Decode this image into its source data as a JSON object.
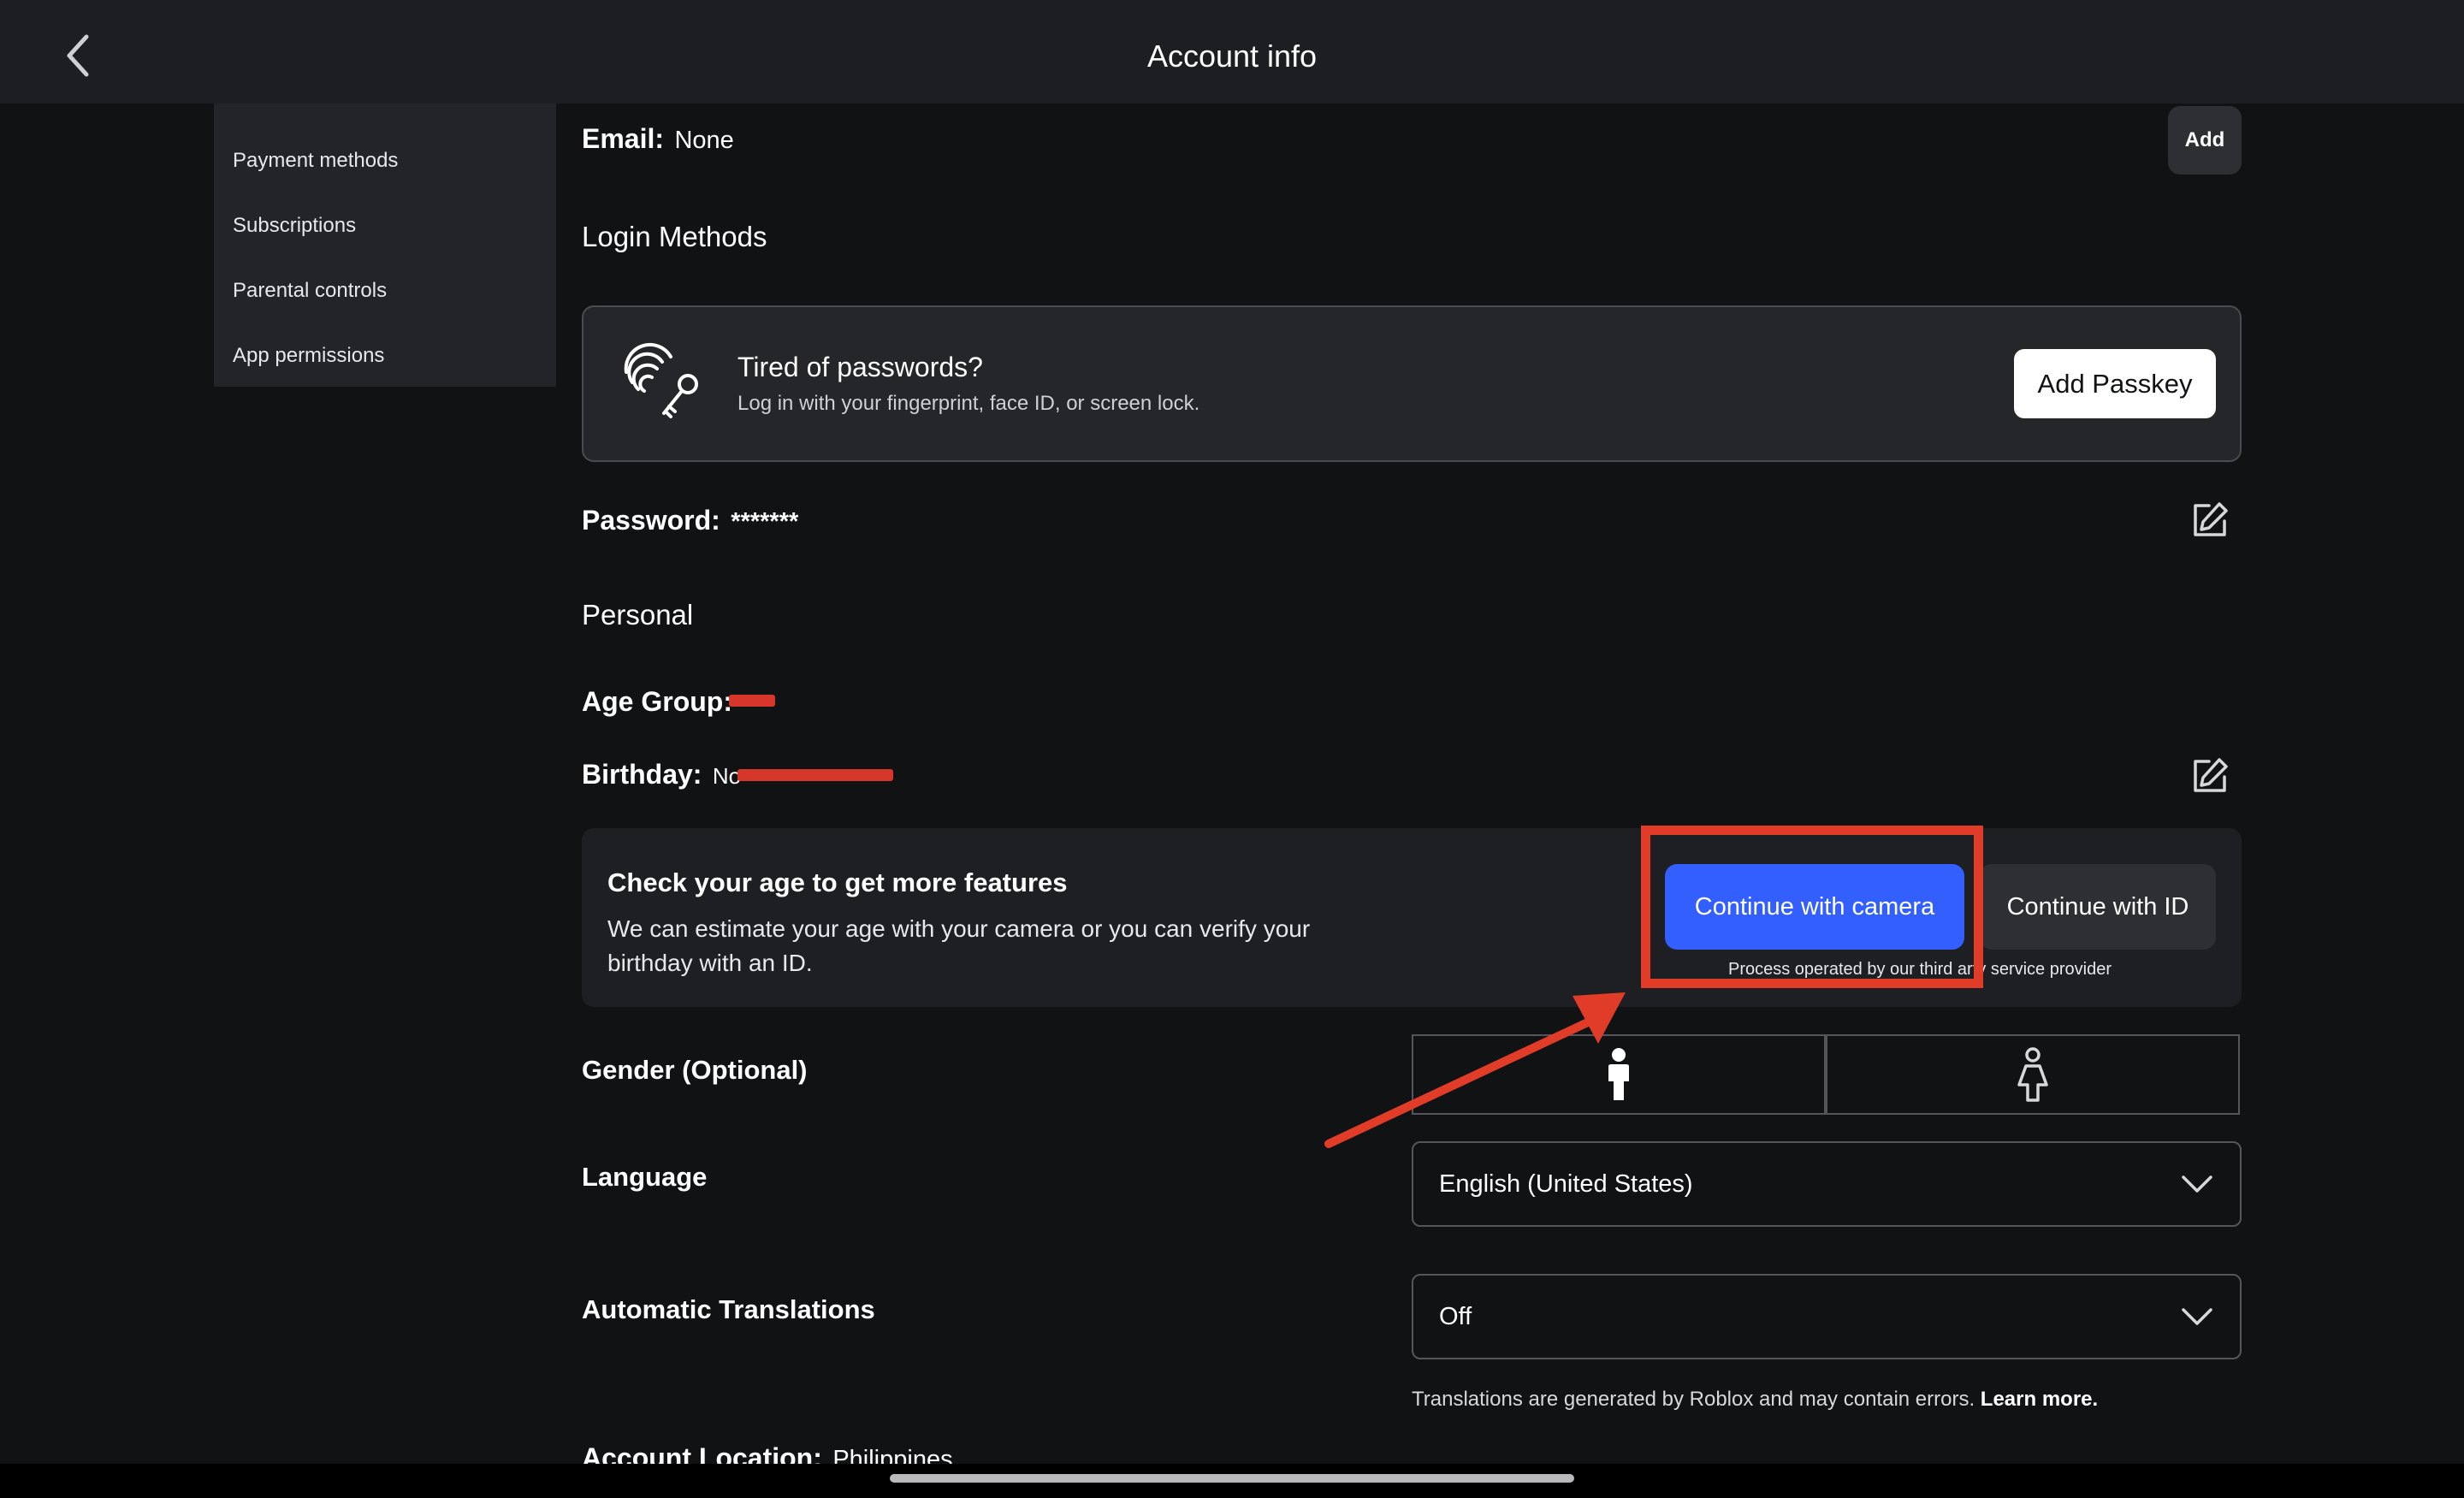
{
  "header": {
    "title": "Account info"
  },
  "sidebar": {
    "items": [
      {
        "label": "Payment methods"
      },
      {
        "label": "Subscriptions"
      },
      {
        "label": "Parental controls"
      },
      {
        "label": "App permissions"
      }
    ]
  },
  "email": {
    "label": "Email:",
    "value": "None",
    "add_label": "Add"
  },
  "login_methods": {
    "title": "Login Methods"
  },
  "passkey": {
    "title": "Tired of passwords?",
    "subtitle": "Log in with your fingerprint, face ID, or screen lock.",
    "button_label": "Add Passkey"
  },
  "password": {
    "label": "Password:",
    "value": "*******"
  },
  "personal": {
    "title": "Personal"
  },
  "age_group": {
    "label": "Age Group:"
  },
  "birthday": {
    "label": "Birthday:",
    "value": "No"
  },
  "age_check": {
    "title": "Check your age to get more features",
    "body_line1": "We can estimate your age with your camera or you can verify your",
    "body_line2": "birthday with an ID.",
    "camera_label": "Continue with camera",
    "id_label": "Continue with ID",
    "provider_note": "Process operated by our third  arty service provider"
  },
  "gender": {
    "label": "Gender (Optional)"
  },
  "language": {
    "label": "Language",
    "value": "English (United States)"
  },
  "auto_translations": {
    "label": "Automatic Translations",
    "value": "Off",
    "note": "Translations are generated by Roblox and may contain errors.",
    "learn_more": "Learn more."
  },
  "account_location": {
    "label": "Account Location:",
    "value": "Philippines"
  },
  "colors": {
    "background": "#111214",
    "header": "#1d1e21",
    "primary_button": "#335fff",
    "annotation_red": "#e13c28"
  }
}
